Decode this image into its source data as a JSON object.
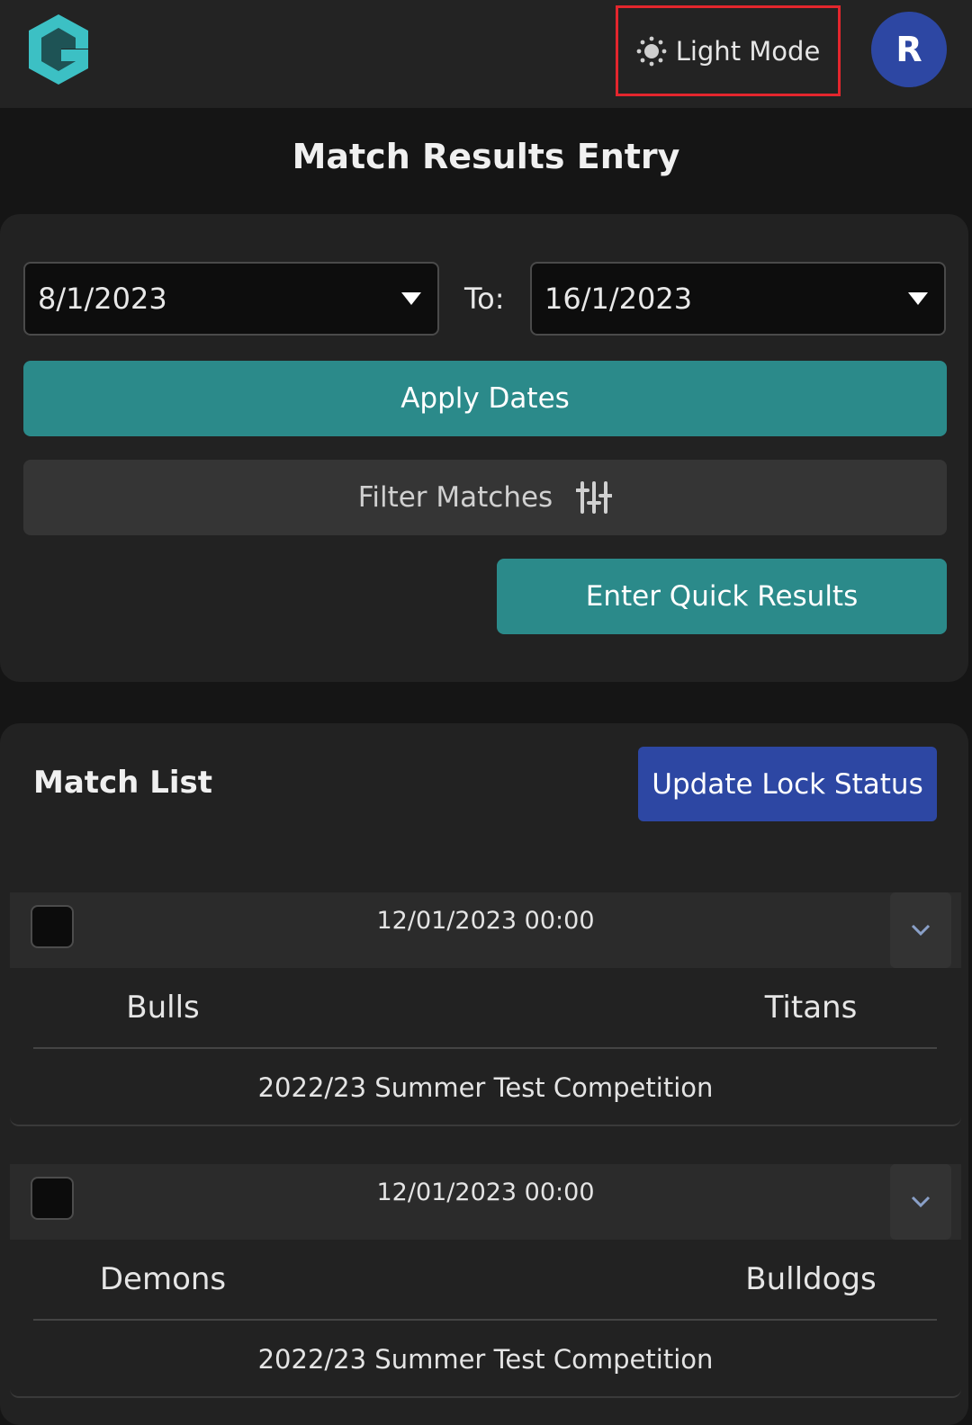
{
  "header": {
    "logo_icon": "g-logo-icon",
    "mode_toggle_label": "Light Mode",
    "mode_icon": "sun-icon",
    "avatar_initial": "R"
  },
  "page": {
    "title": "Match Results Entry"
  },
  "filters": {
    "from_date": "8/1/2023",
    "to_label": "To:",
    "to_date": "16/1/2023",
    "apply_label": "Apply Dates",
    "filter_label": "Filter Matches",
    "filter_icon": "sliders-icon",
    "quick_results_label": "Enter Quick Results"
  },
  "match_list": {
    "title": "Match List",
    "update_lock_label": "Update Lock Status",
    "matches": [
      {
        "datetime": "12/01/2023 00:00",
        "home": "Bulls",
        "away": "Titans",
        "competition": "2022/23 Summer Test Competition",
        "checked": false
      },
      {
        "datetime": "12/01/2023 00:00",
        "home": "Demons",
        "away": "Bulldogs",
        "competition": "2022/23 Summer Test Competition",
        "checked": false
      }
    ]
  },
  "colors": {
    "accent_teal": "#2b8a8a",
    "accent_blue": "#2d47a3",
    "highlight_red": "#e3262d",
    "background": "#151515"
  }
}
